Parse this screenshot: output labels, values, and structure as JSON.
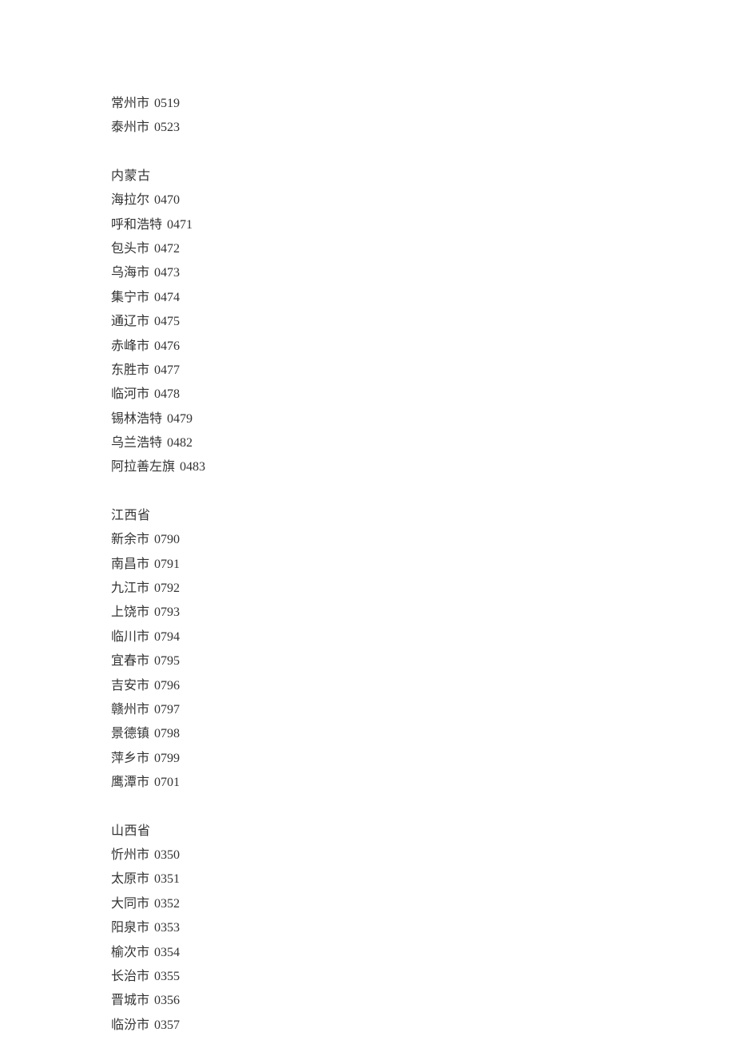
{
  "groups": [
    {
      "header": null,
      "rows": [
        {
          "city": "常州市",
          "code": "0519"
        },
        {
          "city": "泰州市",
          "code": "0523"
        }
      ]
    },
    {
      "header": "内蒙古",
      "rows": [
        {
          "city": "海拉尔",
          "code": "0470"
        },
        {
          "city": "呼和浩特",
          "code": "0471"
        },
        {
          "city": "包头市",
          "code": "0472"
        },
        {
          "city": "乌海市",
          "code": "0473"
        },
        {
          "city": "集宁市",
          "code": "0474"
        },
        {
          "city": "通辽市",
          "code": "0475"
        },
        {
          "city": "赤峰市",
          "code": "0476"
        },
        {
          "city": "东胜市",
          "code": "0477"
        },
        {
          "city": "临河市",
          "code": "0478"
        },
        {
          "city": "锡林浩特",
          "code": "0479"
        },
        {
          "city": "乌兰浩特",
          "code": "0482"
        },
        {
          "city": "阿拉善左旗",
          "code": "0483"
        }
      ]
    },
    {
      "header": "江西省",
      "rows": [
        {
          "city": "新余市",
          "code": "0790"
        },
        {
          "city": "南昌市",
          "code": "0791"
        },
        {
          "city": "九江市",
          "code": "0792"
        },
        {
          "city": "上饶市",
          "code": "0793"
        },
        {
          "city": "临川市",
          "code": "0794"
        },
        {
          "city": "宜春市",
          "code": "0795"
        },
        {
          "city": "吉安市",
          "code": "0796"
        },
        {
          "city": "赣州市",
          "code": "0797"
        },
        {
          "city": "景德镇",
          "code": "0798"
        },
        {
          "city": "萍乡市",
          "code": "0799"
        },
        {
          "city": "鹰潭市",
          "code": "0701"
        }
      ]
    },
    {
      "header": "山西省",
      "rows": [
        {
          "city": "忻州市",
          "code": "0350"
        },
        {
          "city": "太原市",
          "code": "0351"
        },
        {
          "city": "大同市",
          "code": "0352"
        },
        {
          "city": "阳泉市",
          "code": "0353"
        },
        {
          "city": "榆次市",
          "code": "0354"
        },
        {
          "city": "长治市",
          "code": "0355"
        },
        {
          "city": "晋城市",
          "code": "0356"
        },
        {
          "city": "临汾市",
          "code": "0357"
        }
      ]
    }
  ]
}
